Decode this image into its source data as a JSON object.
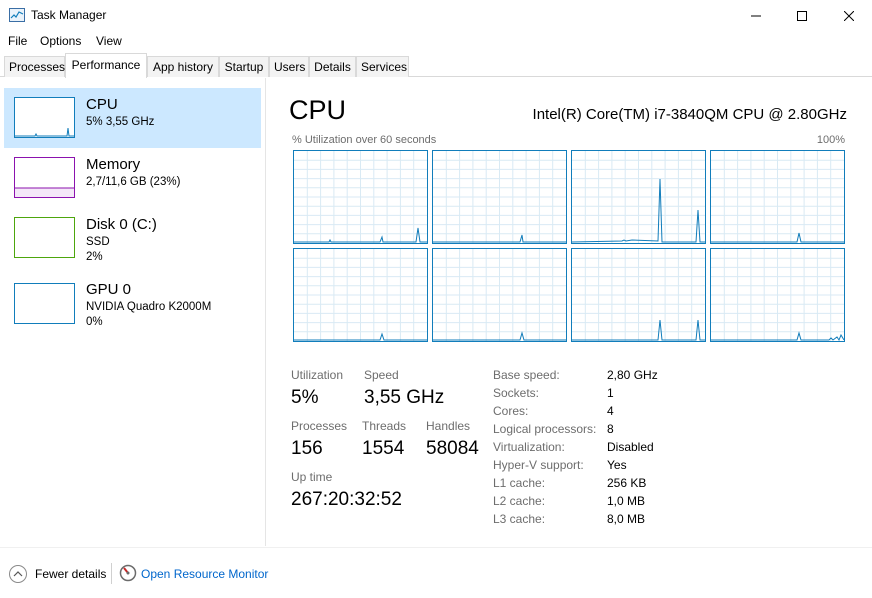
{
  "window": {
    "title": "Task Manager",
    "icon": "task-manager-icon"
  },
  "menu": {
    "items": [
      "File",
      "Options",
      "View"
    ]
  },
  "tabs": [
    {
      "label": "Processes",
      "active": false
    },
    {
      "label": "Performance",
      "active": true
    },
    {
      "label": "App history",
      "active": false
    },
    {
      "label": "Startup",
      "active": false
    },
    {
      "label": "Users",
      "active": false
    },
    {
      "label": "Details",
      "active": false
    },
    {
      "label": "Services",
      "active": false
    }
  ],
  "sidebar": {
    "items": [
      {
        "name": "CPU",
        "line1": "5% 3,55 GHz",
        "line2": "",
        "color": "#117dbb",
        "selected": true
      },
      {
        "name": "Memory",
        "line1": "2,7/11,6 GB (23%)",
        "line2": "",
        "color": "#8b12ae",
        "selected": false
      },
      {
        "name": "Disk 0 (C:)",
        "line1": "SSD",
        "line2": "2%",
        "color": "#4da60c",
        "selected": false
      },
      {
        "name": "GPU 0",
        "line1": "NVIDIA Quadro K2000M",
        "line2": "0%",
        "color": "#117dbb",
        "selected": false
      }
    ]
  },
  "main": {
    "title": "CPU",
    "model": "Intel(R) Core(TM) i7-3840QM CPU @ 2.80GHz",
    "graph_label": "% Utilization over 60 seconds",
    "graph_max": "100%",
    "graph_color": "#117dbb",
    "grid_color": "#d9eaf4",
    "stats": {
      "utilization_label": "Utilization",
      "utilization_value": "5%",
      "speed_label": "Speed",
      "speed_value": "3,55 GHz",
      "processes_label": "Processes",
      "processes_value": "156",
      "threads_label": "Threads",
      "threads_value": "1554",
      "handles_label": "Handles",
      "handles_value": "58084",
      "uptime_label": "Up time",
      "uptime_value": "267:20:32:52"
    },
    "specs": [
      {
        "label": "Base speed:",
        "value": "2,80 GHz"
      },
      {
        "label": "Sockets:",
        "value": "1"
      },
      {
        "label": "Cores:",
        "value": "4"
      },
      {
        "label": "Logical processors:",
        "value": "8"
      },
      {
        "label": "Virtualization:",
        "value": "Disabled"
      },
      {
        "label": "Hyper-V support:",
        "value": "Yes"
      },
      {
        "label": "L1 cache:",
        "value": "256 KB"
      },
      {
        "label": "L2 cache:",
        "value": "1,0 MB"
      },
      {
        "label": "L3 cache:",
        "value": "8,0 MB"
      }
    ]
  },
  "footer": {
    "fewer_details": "Fewer details",
    "open_resource_monitor": "Open Resource Monitor"
  }
}
